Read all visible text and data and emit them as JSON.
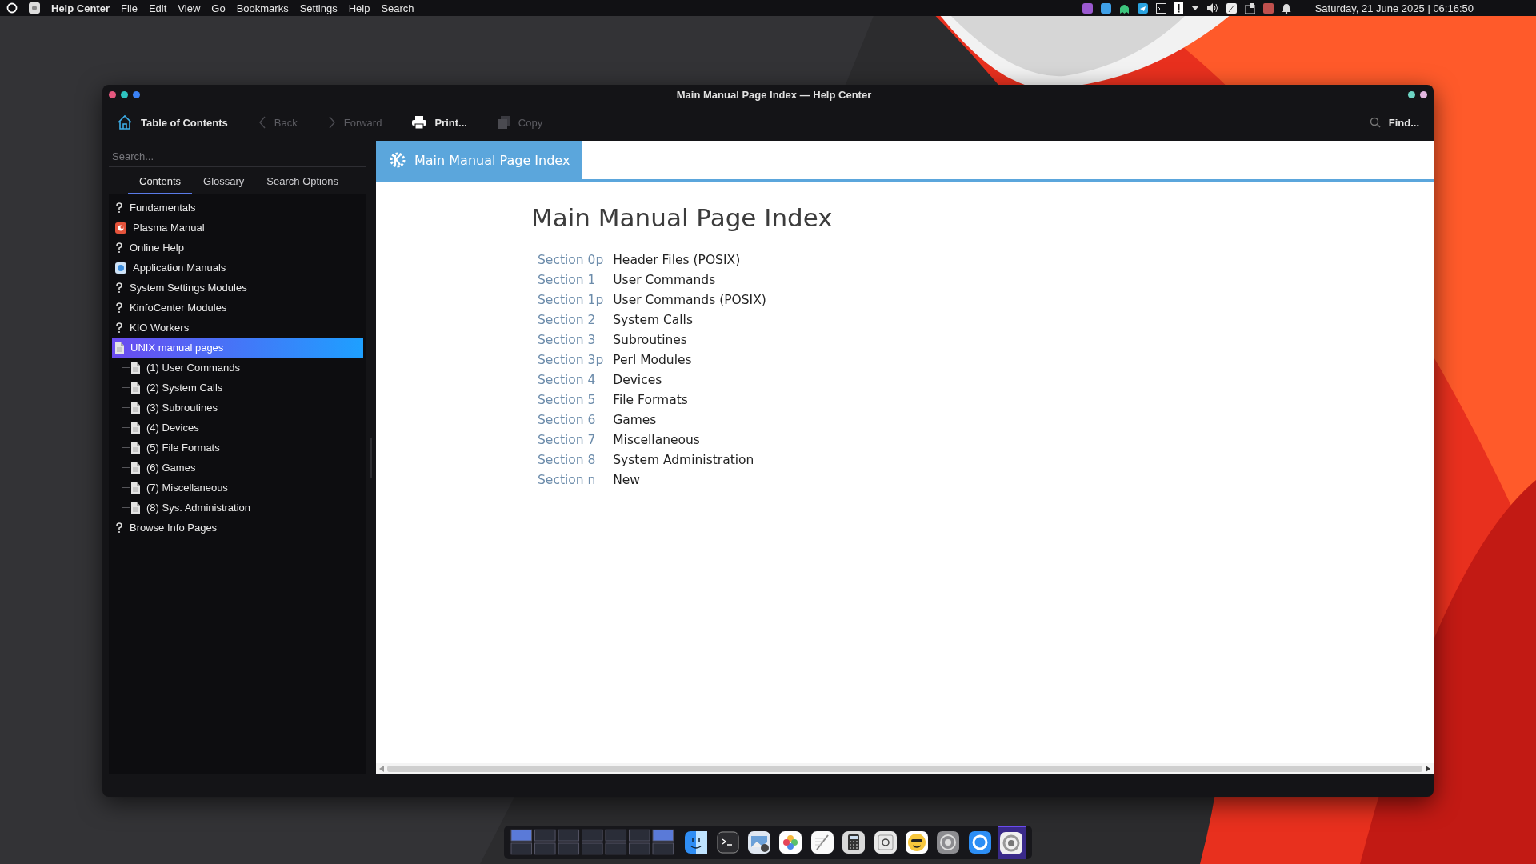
{
  "menubar": {
    "app_name": "Help Center",
    "menus": [
      "File",
      "Edit",
      "View",
      "Go",
      "Bookmarks",
      "Settings",
      "Help",
      "Search"
    ],
    "clock": "Saturday, 21 June 2025 | 06:16:50"
  },
  "window": {
    "title": "Main Manual Page Index — Help Center",
    "toolbar": [
      {
        "kind": "home",
        "label": "Table of Contents",
        "disabled": false
      },
      {
        "kind": "back",
        "label": "Back",
        "disabled": true
      },
      {
        "kind": "forward",
        "label": "Forward",
        "disabled": true
      },
      {
        "kind": "print",
        "label": "Print...",
        "disabled": false
      },
      {
        "kind": "copy",
        "label": "Copy",
        "disabled": true
      }
    ],
    "find_label": "Find...",
    "search": {
      "placeholder": "Search..."
    },
    "tabs": [
      {
        "label": "Contents",
        "selected": true
      },
      {
        "label": "Glossary",
        "selected": false
      },
      {
        "label": "Search Options",
        "selected": false
      }
    ],
    "tree": [
      {
        "kind": "help",
        "label": "Fundamentals",
        "selected": false
      },
      {
        "kind": "plasma",
        "label": "Plasma Manual",
        "selected": false
      },
      {
        "kind": "help",
        "label": "Online Help",
        "selected": false
      },
      {
        "kind": "apps",
        "label": "Application Manuals",
        "selected": false
      },
      {
        "kind": "help",
        "label": "System Settings Modules",
        "selected": false
      },
      {
        "kind": "help",
        "label": "KinfoCenter Modules",
        "selected": false
      },
      {
        "kind": "help",
        "label": "KIO Workers",
        "selected": false
      },
      {
        "kind": "document",
        "label": "UNIX manual pages",
        "selected": true,
        "children": [
          {
            "kind": "document",
            "label": "(1) User Commands",
            "selected": false
          },
          {
            "kind": "document",
            "label": "(2) System Calls",
            "selected": false
          },
          {
            "kind": "document",
            "label": "(3) Subroutines",
            "selected": false
          },
          {
            "kind": "document",
            "label": "(4) Devices",
            "selected": false
          },
          {
            "kind": "document",
            "label": "(5) File Formats",
            "selected": false
          },
          {
            "kind": "document",
            "label": "(6) Games",
            "selected": false
          },
          {
            "kind": "document",
            "label": "(7) Miscellaneous",
            "selected": false
          },
          {
            "kind": "document",
            "label": "(8) Sys. Administration",
            "selected": false
          }
        ]
      },
      {
        "kind": "help",
        "label": "Browse Info Pages",
        "selected": false
      }
    ],
    "page": {
      "banner": "Main Manual Page Index",
      "heading": "Main Manual Page Index",
      "sections": [
        {
          "section": "Section 0p",
          "title": "Header Files (POSIX)"
        },
        {
          "section": "Section 1",
          "title": "User Commands"
        },
        {
          "section": "Section 1p",
          "title": "User Commands (POSIX)"
        },
        {
          "section": "Section 2",
          "title": "System Calls"
        },
        {
          "section": "Section 3",
          "title": "Subroutines"
        },
        {
          "section": "Section 3p",
          "title": "Perl Modules"
        },
        {
          "section": "Section 4",
          "title": "Devices"
        },
        {
          "section": "Section 5",
          "title": "File Formats"
        },
        {
          "section": "Section 6",
          "title": "Games"
        },
        {
          "section": "Section 7",
          "title": "Miscellaneous"
        },
        {
          "section": "Section 8",
          "title": "System Administration"
        },
        {
          "section": "Section n",
          "title": "New"
        }
      ]
    }
  },
  "dock": [
    {
      "kind": "finder",
      "selected": false
    },
    {
      "kind": "terminal",
      "selected": false
    },
    {
      "kind": "preview",
      "selected": false
    },
    {
      "kind": "photos",
      "selected": false
    },
    {
      "kind": "notes",
      "selected": false
    },
    {
      "kind": "calculator",
      "selected": false
    },
    {
      "kind": "keyboard",
      "selected": false
    },
    {
      "kind": "emoji",
      "selected": false
    },
    {
      "kind": "settings",
      "selected": false
    },
    {
      "kind": "browser",
      "selected": false
    },
    {
      "kind": "help",
      "selected": true
    }
  ]
}
